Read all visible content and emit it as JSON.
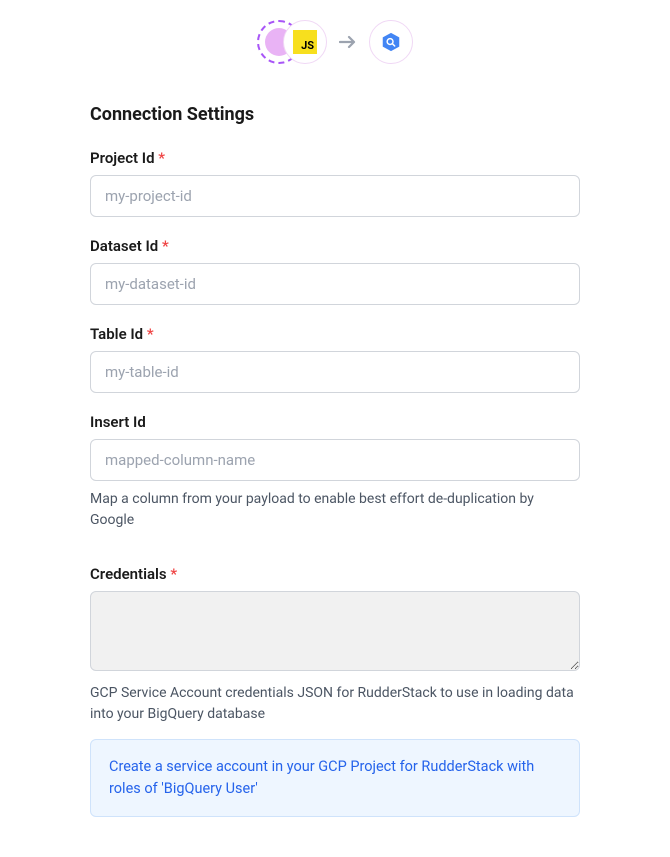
{
  "header": {
    "source_badge_text": "JS"
  },
  "section_title": "Connection Settings",
  "fields": {
    "project_id": {
      "label": "Project Id",
      "required_marker": "*",
      "placeholder": "my-project-id",
      "value": ""
    },
    "dataset_id": {
      "label": "Dataset Id",
      "required_marker": "*",
      "placeholder": "my-dataset-id",
      "value": ""
    },
    "table_id": {
      "label": "Table Id",
      "required_marker": "*",
      "placeholder": "my-table-id",
      "value": ""
    },
    "insert_id": {
      "label": "Insert Id",
      "placeholder": "mapped-column-name",
      "value": "",
      "help": "Map a column from your payload to enable best effort de-duplication by Google"
    },
    "credentials": {
      "label": "Credentials",
      "required_marker": "*",
      "value": "",
      "help": "GCP Service Account credentials JSON for RudderStack to use in loading data into your BigQuery database",
      "link_text": "Create a service account in your GCP Project for RudderStack with roles of 'BigQuery User'"
    }
  }
}
